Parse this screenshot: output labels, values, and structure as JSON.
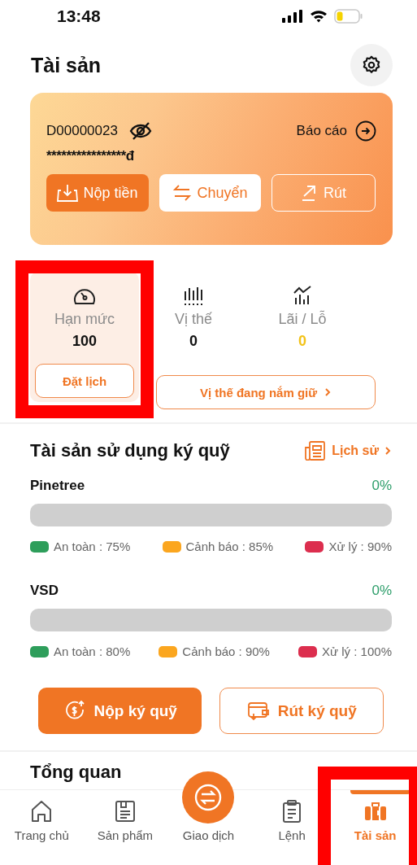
{
  "status_bar": {
    "time": "13:48"
  },
  "header": {
    "title": "Tài sản"
  },
  "account_card": {
    "account": "D00000023",
    "report_label": "Báo cáo",
    "balance": "****************đ",
    "actions": [
      {
        "kind": "deposit",
        "label": "Nộp tiền"
      },
      {
        "kind": "transfer",
        "label": "Chuyển"
      },
      {
        "kind": "withdraw",
        "label": "Rút"
      }
    ]
  },
  "stats": [
    {
      "kind": "limit",
      "label": "Hạn mức",
      "value": "100",
      "selected": true
    },
    {
      "kind": "position",
      "label": "Vị thế",
      "value": "0",
      "selected": false
    },
    {
      "kind": "pnl",
      "label": "Lãi / Lỗ",
      "value": "0",
      "selected": false
    }
  ],
  "stat_buttons": [
    "Đặt lịch",
    "Vị thế đang nắm giữ"
  ],
  "margin": {
    "title": "Tài sản sử dụng ký quỹ",
    "history_label": "Lịch sử",
    "groups": [
      {
        "name": "Pinetree",
        "percent": "0%",
        "level": 0,
        "thresholds": [
          {
            "label": "An toàn : 75%",
            "color": "#2e9e5b"
          },
          {
            "label": "Cảnh báo : 85%",
            "color": "#fba61f"
          },
          {
            "label": "Xử lý : 90%",
            "color": "#dc2e4e"
          }
        ]
      },
      {
        "name": "VSD",
        "percent": "0%",
        "level": 0,
        "thresholds": [
          {
            "label": "An toàn : 80%",
            "color": "#2e9e5b"
          },
          {
            "label": "Cảnh báo : 90%",
            "color": "#fba61f"
          },
          {
            "label": "Xử lý : 100%",
            "color": "#dc2e4e"
          }
        ]
      }
    ],
    "buttons": [
      {
        "kind": "deposit",
        "label": "Nộp ký quỹ"
      },
      {
        "kind": "withdraw",
        "label": "Rút ký quỹ"
      }
    ]
  },
  "overview": {
    "title": "Tổng quan"
  },
  "nav": [
    {
      "kind": "home",
      "label": "Trang chủ",
      "selected": false
    },
    {
      "kind": "products",
      "label": "Sản phẩm",
      "selected": false
    },
    {
      "kind": "trade",
      "label": "Giao dịch",
      "selected": false
    },
    {
      "kind": "orders",
      "label": "Lệnh",
      "selected": false
    },
    {
      "kind": "assets",
      "label": "Tài sản",
      "selected": true
    }
  ]
}
